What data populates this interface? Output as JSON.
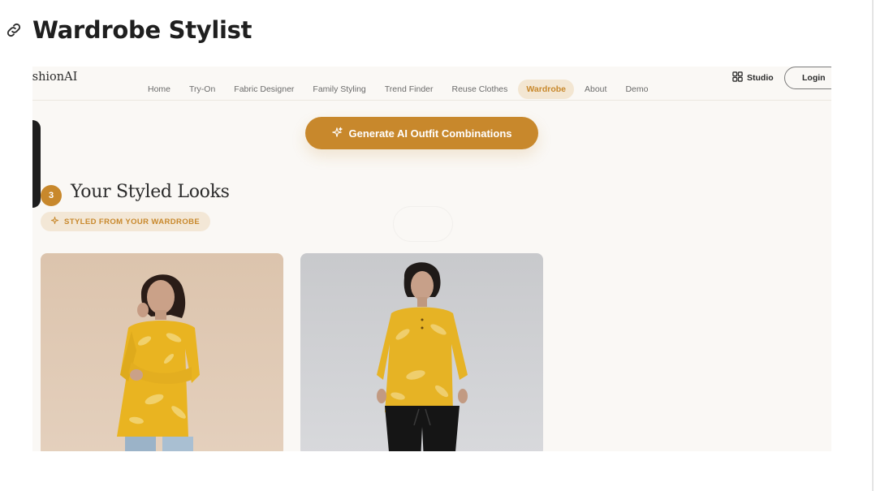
{
  "doc": {
    "title": "Wardrobe Stylist",
    "link_icon": "link-icon"
  },
  "app": {
    "brand": "ashionAI",
    "nav": [
      {
        "label": "Home",
        "active": false
      },
      {
        "label": "Try-On",
        "active": false
      },
      {
        "label": "Fabric Designer",
        "active": false
      },
      {
        "label": "Family Styling",
        "active": false
      },
      {
        "label": "Trend Finder",
        "active": false
      },
      {
        "label": "Reuse Clothes",
        "active": false
      },
      {
        "label": "Wardrobe",
        "active": true
      },
      {
        "label": "About",
        "active": false
      },
      {
        "label": "Demo",
        "active": false
      }
    ],
    "studio_label": "Studio",
    "login_label": "Login",
    "cta_label": "Generate AI Outfit Combinations",
    "step_number": "3",
    "section_title": "Your Styled Looks",
    "section_badge": "STYLED FROM YOUR WARDROBE",
    "accent_color": "#c8882c"
  }
}
